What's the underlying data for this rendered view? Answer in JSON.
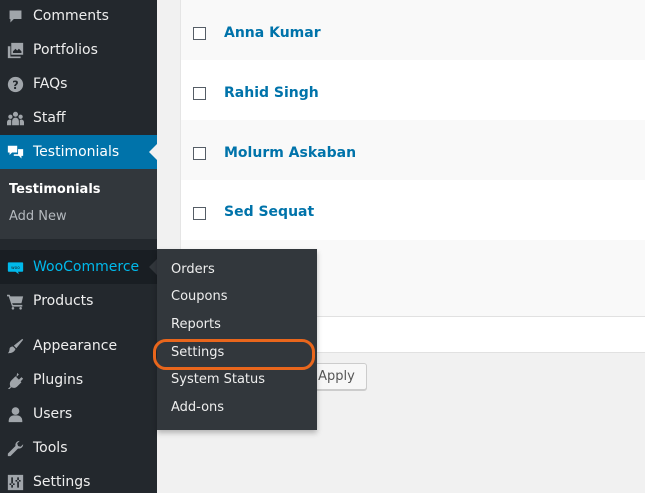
{
  "sidebar": {
    "items": [
      {
        "label": "Comments",
        "icon": "comment-icon"
      },
      {
        "label": "Portfolios",
        "icon": "portfolio-icon"
      },
      {
        "label": "FAQs",
        "icon": "question-icon"
      },
      {
        "label": "Staff",
        "icon": "staff-icon"
      },
      {
        "label": "Testimonials",
        "icon": "testimonial-icon"
      },
      {
        "label": "WooCommerce",
        "icon": "woocommerce-icon"
      },
      {
        "label": "Products",
        "icon": "cart-icon"
      },
      {
        "label": "Appearance",
        "icon": "brush-icon"
      },
      {
        "label": "Plugins",
        "icon": "plugin-icon"
      },
      {
        "label": "Users",
        "icon": "user-icon"
      },
      {
        "label": "Tools",
        "icon": "wrench-icon"
      },
      {
        "label": "Settings",
        "icon": "sliders-icon"
      }
    ],
    "submenu": [
      "Testimonials",
      "Add New"
    ]
  },
  "woo_flyout": {
    "items": [
      "Orders",
      "Coupons",
      "Reports",
      "Settings",
      "System Status",
      "Add-ons"
    ],
    "highlighted": "Settings",
    "highlight_color": "#e9661c"
  },
  "list": {
    "rows": [
      "Anna Kumar",
      "Rahid Singh",
      "Molurm Askaban",
      "Sed Sequat"
    ]
  },
  "bulk": {
    "apply_label": "Apply"
  },
  "colors": {
    "sidebar_bg": "#23282d",
    "active": "#0073aa",
    "link": "#0073aa",
    "hover_text": "#00b9eb"
  }
}
